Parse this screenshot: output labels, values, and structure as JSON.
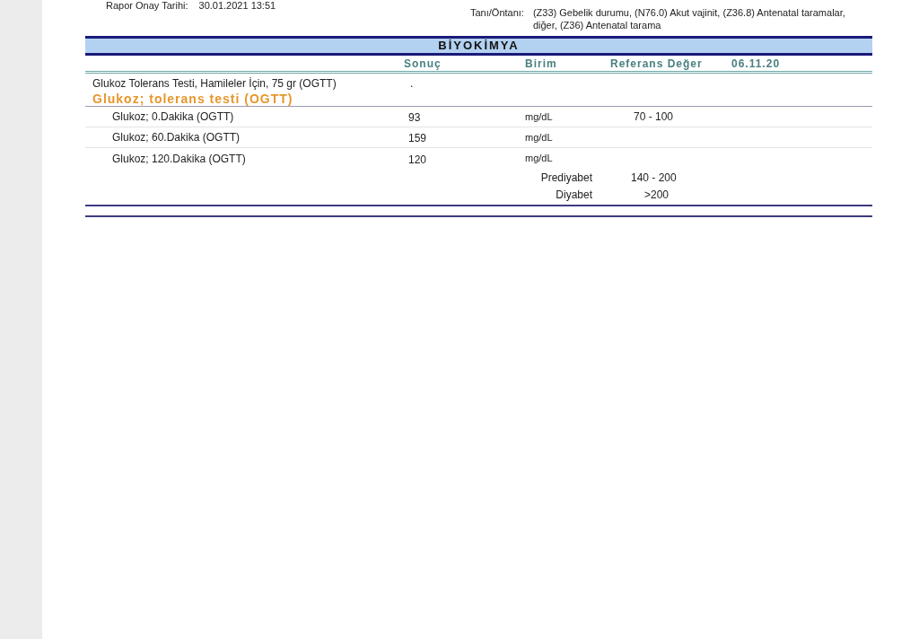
{
  "header": {
    "approval_label": "Rapor Onay Tarihi:",
    "approval_value": "30.01.2021 13:51",
    "diagnosis_label": "Tanı/Öntanı:",
    "diagnosis_value": "(Z33) Gebelik durumu, (N76.0) Akut vajinit, (Z36.8) Antenatal taramalar, diğer, (Z36) Antenatal tarama"
  },
  "section_title": "BİYOKİMYA",
  "columns": [
    "Sonuç",
    "Birim",
    "Referans Değer",
    "06.11.20"
  ],
  "test": {
    "name": "Glukoz Tolerans Testi, Hamileler İçin, 75 gr (OGTT)",
    "result": "."
  },
  "group_title": "Glukoz; tolerans testi (OGTT)",
  "rows": [
    {
      "name": "Glukoz; 0.Dakika (OGTT)",
      "result": "93",
      "unit": "mg/dL",
      "reference": "70 - 100"
    },
    {
      "name": "Glukoz; 60.Dakika (OGTT)",
      "result": "159",
      "unit": "mg/dL"
    },
    {
      "name": "Glukoz; 120.Dakika (OGTT)",
      "result": "120",
      "unit": "mg/dL"
    }
  ],
  "reference_ranges": [
    {
      "label": "Prediyabet",
      "range": "140 - 200"
    },
    {
      "label": "Diyabet",
      "range": ">200"
    }
  ]
}
